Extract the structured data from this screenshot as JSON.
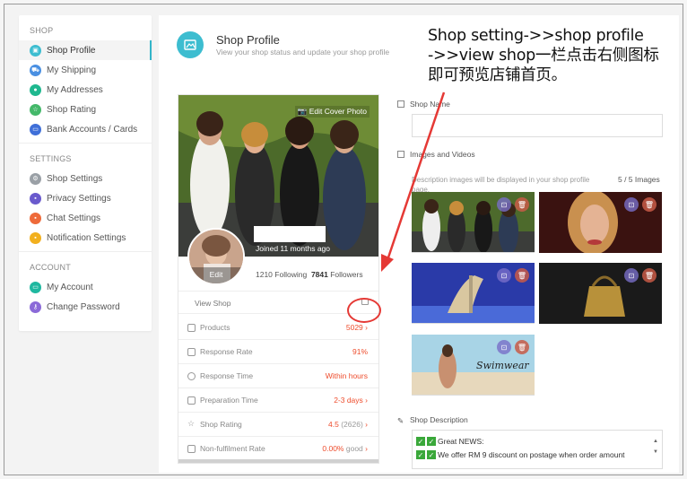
{
  "sidebar": {
    "sections": [
      {
        "head": "SHOP",
        "items": [
          {
            "label": "Shop Profile",
            "icon": "shop-profile-icon",
            "color": "#3dbdd0",
            "active": true
          },
          {
            "label": "My Shipping",
            "icon": "shipping-truck-icon",
            "color": "#4a90e2"
          },
          {
            "label": "My Addresses",
            "icon": "map-pin-icon",
            "color": "#1fb88f"
          },
          {
            "label": "Shop Rating",
            "icon": "star-icon",
            "color": "#44b86a"
          },
          {
            "label": "Bank Accounts / Cards",
            "icon": "bank-card-icon",
            "color": "#3f6fd8"
          }
        ]
      },
      {
        "head": "SETTINGS",
        "items": [
          {
            "label": "Shop Settings",
            "icon": "gear-icon",
            "color": "#9aa0a6"
          },
          {
            "label": "Privacy Settings",
            "icon": "lock-icon",
            "color": "#6a5acd"
          },
          {
            "label": "Chat Settings",
            "icon": "chat-bubble-icon",
            "color": "#ee6a3a"
          },
          {
            "label": "Notification Settings",
            "icon": "bell-icon",
            "color": "#f2b01e"
          }
        ]
      },
      {
        "head": "ACCOUNT",
        "items": [
          {
            "label": "My Account",
            "icon": "id-card-icon",
            "color": "#1fb8a0"
          },
          {
            "label": "Change Password",
            "icon": "key-icon",
            "color": "#8b6ad8"
          }
        ]
      }
    ]
  },
  "header": {
    "title": "Shop Profile",
    "subtitle": "View your shop status and update your shop profile"
  },
  "annotation": {
    "line1": "Shop setting->>shop profile",
    "line2": "->>view shop一栏点击右侧图标",
    "line3": "即可预览店铺首页。",
    "color": "#e53935"
  },
  "profile": {
    "edit_cover": "Edit Cover Photo",
    "joined": "Joined 11 months ago",
    "avatar_edit": "Edit",
    "following_count": "1210",
    "following_label": "Following",
    "followers_count": "7841",
    "followers_label": "Followers",
    "view_shop": "View Shop"
  },
  "stats": [
    {
      "label": "Products",
      "value": "5029",
      "suffix": "",
      "chevron": true,
      "icon": "box-icon"
    },
    {
      "label": "Response Rate",
      "value": "91%",
      "suffix": "",
      "chevron": false,
      "icon": "chat-icon"
    },
    {
      "label": "Response Time",
      "value": "Within hours",
      "suffix": "",
      "chevron": false,
      "icon": "clock-icon"
    },
    {
      "label": "Preparation Time",
      "value": "2-3 days",
      "suffix": "",
      "chevron": true,
      "icon": "truck-icon"
    },
    {
      "label": "Shop Rating",
      "value": "4.5",
      "suffix": "(2626)",
      "chevron": true,
      "icon": "star-outline-icon"
    },
    {
      "label": "Non-fulfilment Rate",
      "value": "0.00%",
      "suffix": "good",
      "chevron": true,
      "icon": "calendar-icon"
    }
  ],
  "form": {
    "shop_name_label": "Shop Name",
    "images_label": "Images and Videos",
    "images_desc": "Description images will be displayed in your shop profile page.",
    "images_count": "5 / 5 Images",
    "description_label": "Shop Description",
    "description_lines": [
      "Great NEWS:",
      "We offer RM 9 discount on postage when order amount"
    ],
    "swimwear_text": "Swimwear"
  },
  "colors": {
    "accent": "#3dbdd0",
    "orange": "#ee4d2d"
  }
}
